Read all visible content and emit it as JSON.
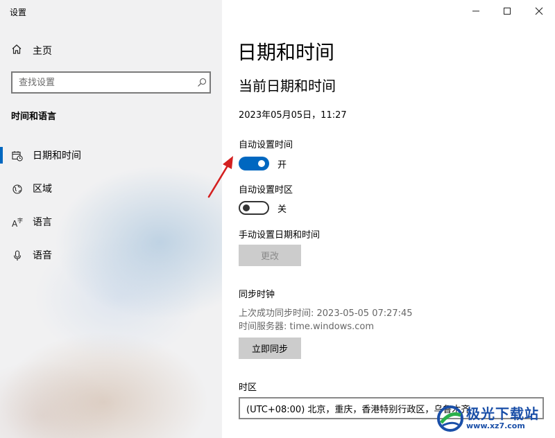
{
  "window": {
    "title": "设置"
  },
  "sidebar": {
    "home_label": "主页",
    "search_placeholder": "查找设置",
    "section_title": "时间和语言",
    "items": [
      {
        "label": "日期和时间",
        "icon": "calendar-clock-icon",
        "selected": true
      },
      {
        "label": "区域",
        "icon": "globe-icon",
        "selected": false
      },
      {
        "label": "语言",
        "icon": "language-icon",
        "selected": false
      },
      {
        "label": "语音",
        "icon": "microphone-icon",
        "selected": false
      }
    ]
  },
  "main": {
    "title": "日期和时间",
    "subtitle": "当前日期和时间",
    "current_datetime": "2023年05月05日，11:27",
    "auto_time": {
      "label": "自动设置时间",
      "state_label": "开",
      "on": true
    },
    "auto_timezone": {
      "label": "自动设置时区",
      "state_label": "关",
      "on": false
    },
    "manual": {
      "label": "手动设置日期和时间",
      "button": "更改"
    },
    "sync": {
      "title": "同步时钟",
      "last_sync": "上次成功同步时间: 2023-05-05 07:27:45",
      "server": "时间服务器: time.windows.com",
      "button": "立即同步"
    },
    "timezone": {
      "label": "时区",
      "value": "(UTC+08:00) 北京，重庆，香港特别行政区，乌鲁木齐"
    }
  },
  "watermark": {
    "name": "极光下载站",
    "url": "www.xz7.com"
  },
  "colors": {
    "accent": "#0067c0",
    "arrow": "#d42020",
    "watermark": "#1a4fa8"
  }
}
